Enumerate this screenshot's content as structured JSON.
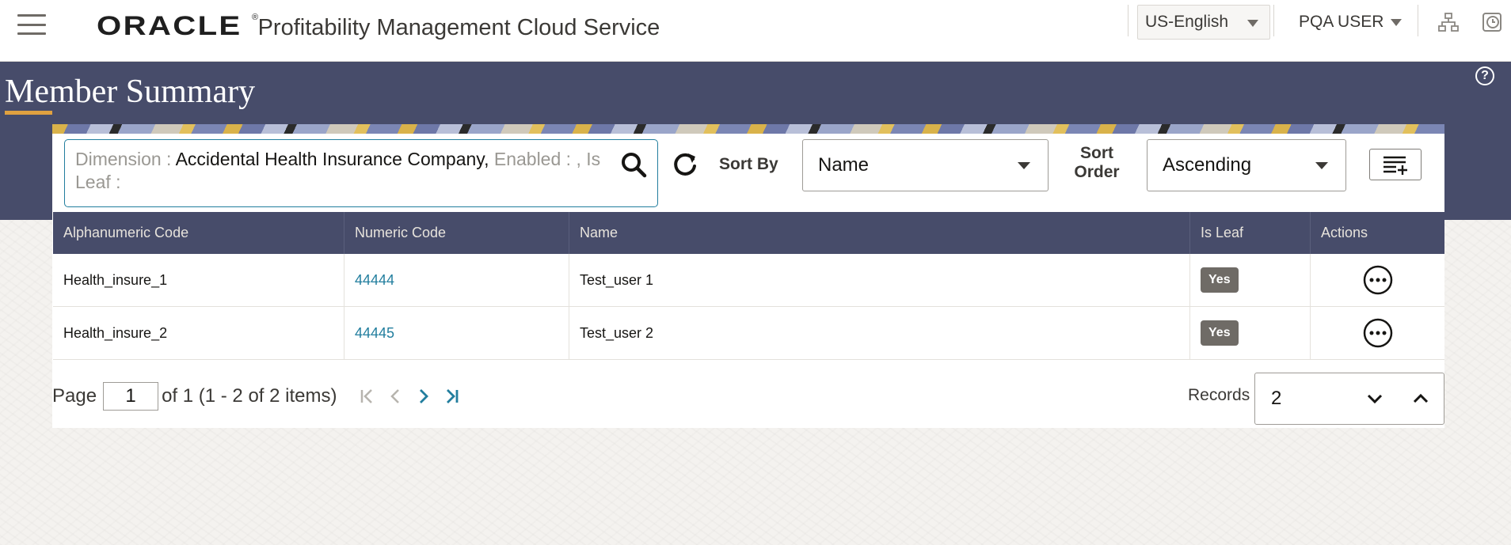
{
  "header": {
    "brand_logo": "ORACLE",
    "brand_registered": "®",
    "product_name": "Profitability Management Cloud Service",
    "language": "US-English",
    "user": "PQA USER"
  },
  "page": {
    "title": "Member Summary",
    "help": "?"
  },
  "filter": {
    "dimension_label": "Dimension : ",
    "dimension_value": "Accidental Health Insurance Company,",
    "enabled_label": " Enabled : , Is Leaf :"
  },
  "sort": {
    "sort_by_label": "Sort By",
    "sort_by_value": "Name",
    "sort_order_label": "Sort Order",
    "sort_order_value": "Ascending"
  },
  "table": {
    "columns": [
      "Alphanumeric Code",
      "Numeric Code",
      "Name",
      "Is Leaf",
      "Actions"
    ],
    "rows": [
      {
        "alpha": "Health_insure_1",
        "numeric": "44444",
        "name": "Test_user 1",
        "is_leaf": "Yes"
      },
      {
        "alpha": "Health_insure_2",
        "numeric": "44445",
        "name": "Test_user 2",
        "is_leaf": "Yes"
      }
    ]
  },
  "pagination": {
    "page_label": "Page",
    "page_value": "1",
    "summary": "of 1 (1 - 2 of 2 items)",
    "records_label": "Records",
    "records_value": "2"
  },
  "icons": {
    "menu": "hamburger-icon",
    "search": "search-icon",
    "refresh": "refresh-icon",
    "columns": "manage-columns-icon",
    "actions": "more-actions-icon",
    "hierarchy": "hierarchy-icon",
    "clock": "clock-icon"
  },
  "colors": {
    "band": "#474c6a",
    "accent": "#227e9e",
    "title_underline": "#e0a140",
    "badge": "#6f6b66"
  }
}
